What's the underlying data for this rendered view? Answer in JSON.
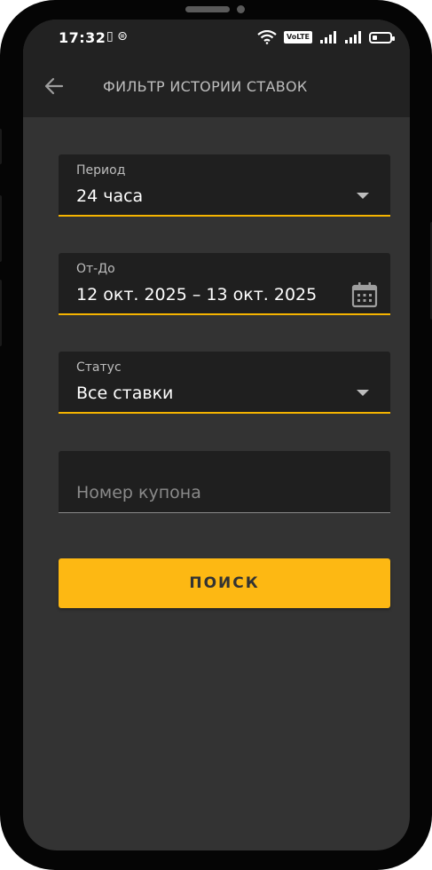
{
  "status_bar": {
    "time": "17:32",
    "left_icons": "▯ ⊜",
    "volte": "VoLTE",
    "battery_level": 0.3
  },
  "app_bar": {
    "back_icon": "arrow-left",
    "title": "ФИЛЬТР ИСТОРИИ СТАВОК"
  },
  "form": {
    "period": {
      "label": "Период",
      "value": "24 часа"
    },
    "date_range": {
      "label": "От-До",
      "value": "12 окт. 2025 – 13 окт. 2025"
    },
    "status": {
      "label": "Статус",
      "value": "Все ставки"
    },
    "coupon": {
      "placeholder": "Номер купона",
      "value": ""
    }
  },
  "search_button": {
    "label": "ПОИСК"
  },
  "colors": {
    "accent": "#fdb813",
    "background": "#333333",
    "field_bg": "#1f1f1f",
    "bar_bg": "#222222"
  }
}
